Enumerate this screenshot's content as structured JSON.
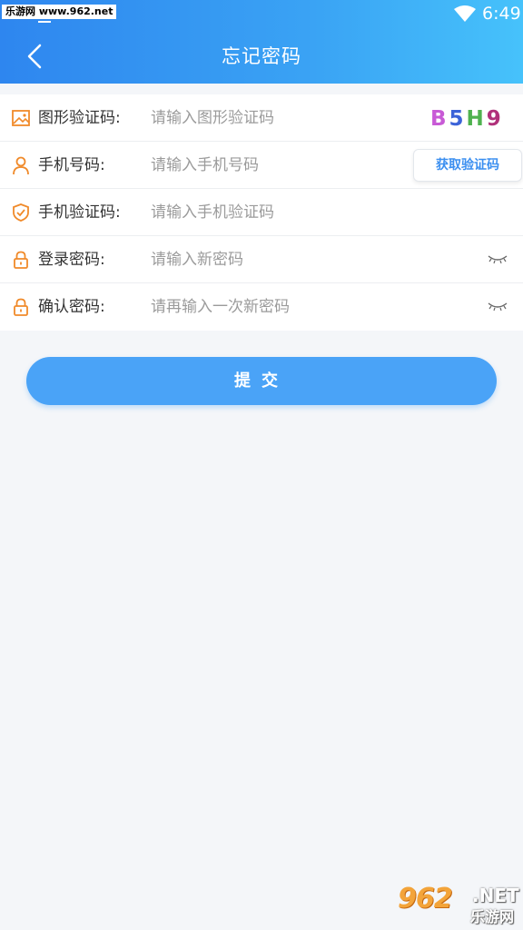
{
  "statusbar": {
    "watermark": "乐游网 www.962.net",
    "time": "6:49"
  },
  "header": {
    "title": "忘记密码"
  },
  "form": {
    "rows": [
      {
        "label": "图形验证码:",
        "placeholder": "请输入图形验证码",
        "icon": "image-icon"
      },
      {
        "label": "手机号码:",
        "placeholder": "请输入手机号码",
        "icon": "user-icon"
      },
      {
        "label": "手机验证码:",
        "placeholder": "请输入手机验证码",
        "icon": "shield-icon"
      },
      {
        "label": "登录密码:",
        "placeholder": "请输入新密码",
        "icon": "lock-icon"
      },
      {
        "label": "确认密码:",
        "placeholder": "请再输入一次新密码",
        "icon": "lock-icon"
      }
    ],
    "captcha": [
      "B",
      "5",
      "H",
      "9"
    ],
    "get_code_label": "获取验证码"
  },
  "submit_label": "提交",
  "watermark_bottom": {
    "number": "962",
    "suffix": ".NET",
    "name": "乐游网"
  },
  "colors": {
    "accent": "#4aa3f7",
    "icon": "#f08a2a",
    "header_start": "#2e86ef",
    "header_end": "#46c2fb"
  }
}
